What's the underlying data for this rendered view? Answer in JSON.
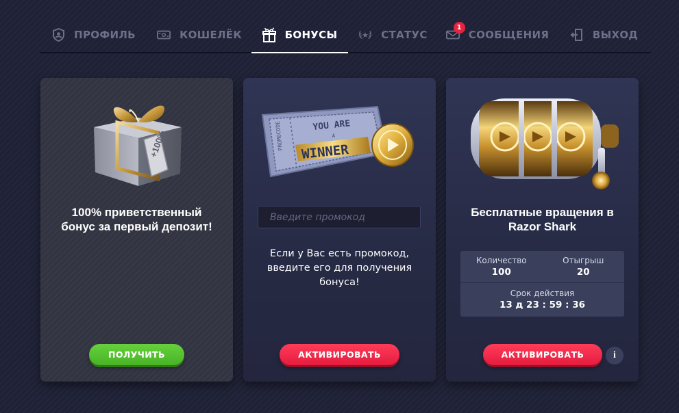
{
  "nav": {
    "items": [
      {
        "label": "ПРОФИЛЬ",
        "icon": "shield-user-icon"
      },
      {
        "label": "КОШЕЛЁК",
        "icon": "wallet-icon"
      },
      {
        "label": "БОНУСЫ",
        "icon": "gift-icon",
        "active": true
      },
      {
        "label": "СТАТУС",
        "icon": "laurel-icon"
      },
      {
        "label": "СООБЩЕНИЯ",
        "icon": "envelope-icon",
        "badge": "1"
      },
      {
        "label": "ВЫХОД",
        "icon": "exit-door-icon"
      }
    ]
  },
  "cards": {
    "welcome": {
      "title": "100% приветственный бонус за первый депозит!",
      "tag_text": "+100%",
      "button": "ПОЛУЧИТЬ"
    },
    "promo": {
      "ticket_line1": "YOU ARE",
      "ticket_line2": "A",
      "ticket_line3": "WINNER",
      "ticket_side": "PROMOCODE",
      "placeholder": "Введите промокод",
      "text": "Если у Вас есть промокод, введите его для получения бонуса!",
      "button": "АКТИВИРОВАТЬ"
    },
    "spins": {
      "title": "Бесплатные вращения в Razor Shark",
      "quantity_label": "Количество",
      "quantity_value": "100",
      "wager_label": "Отыгрыш",
      "wager_value": "20",
      "validity_label": "Срок действия",
      "validity_value": "13 д 23 : 59 : 36",
      "button": "АКТИВИРОВАТЬ",
      "info": "i"
    }
  },
  "colors": {
    "background": "#1f2236",
    "accent_green": "#55c22e",
    "accent_red": "#f2284a",
    "badge_red": "#e8233f",
    "nav_inactive": "#6c7089"
  }
}
